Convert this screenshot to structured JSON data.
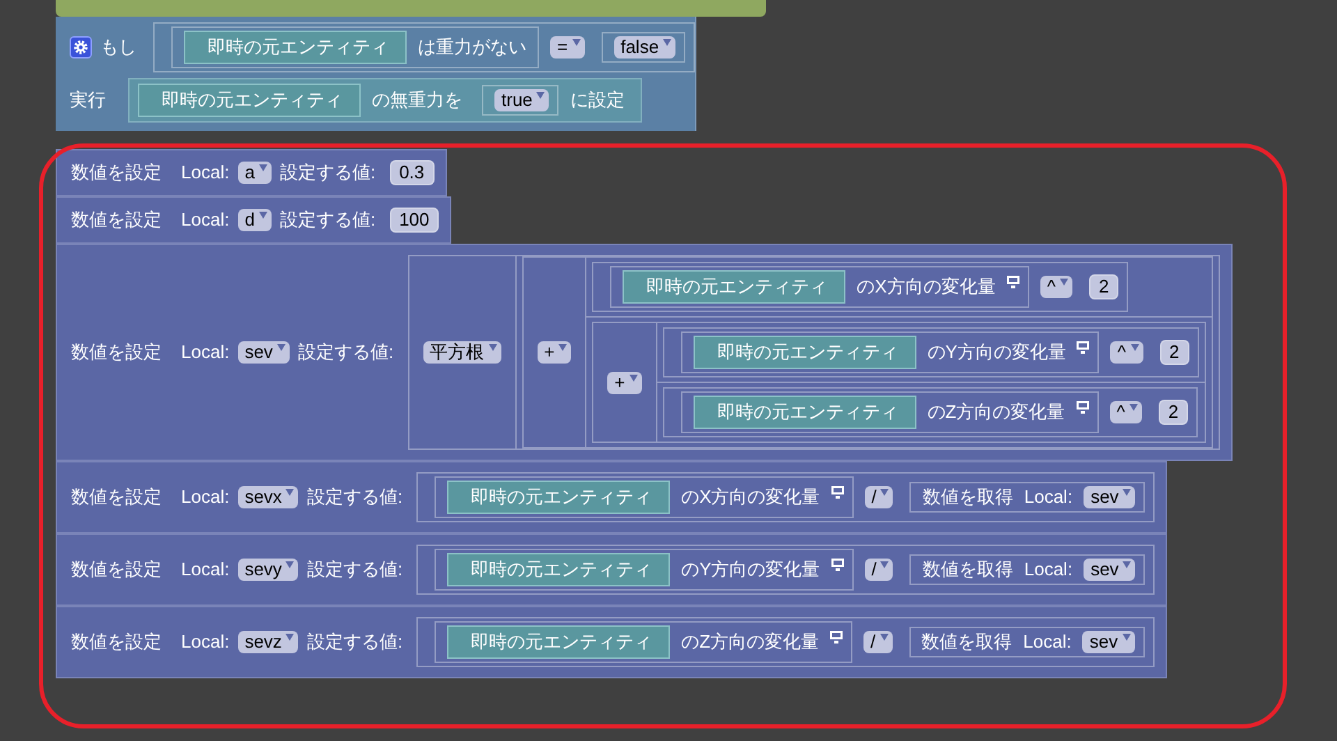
{
  "if_block": {
    "label": "もし",
    "condition": {
      "kind": "op",
      "inline": true,
      "op": "=",
      "left": {
        "kind": "property",
        "entity": "即時の元エンティティ",
        "text": "は重力がない"
      },
      "right": {
        "kind": "boolean",
        "text": "false"
      }
    },
    "do_label": "実行",
    "statement": {
      "entity": "即時の元エンティティ",
      "text_before": "の無重力を",
      "value": {
        "kind": "boolean",
        "text": "true"
      },
      "text_after": "に設定"
    }
  },
  "set_blocks": [
    {
      "label": "数値を設定",
      "scope": "Local:",
      "variable": "a",
      "value_label": "設定する値:",
      "value": {
        "kind": "number",
        "text": "0.3"
      }
    },
    {
      "label": "数値を設定",
      "scope": "Local:",
      "variable": "d",
      "value_label": "設定する値:",
      "value": {
        "kind": "number",
        "text": "100"
      }
    },
    {
      "label": "数値を設定",
      "scope": "Local:",
      "variable": "sev",
      "value_label": "設定する値:",
      "value": {
        "kind": "function",
        "function": "平方根",
        "arg": {
          "kind": "op",
          "inline": false,
          "op": "+",
          "left": {
            "kind": "op",
            "inline": true,
            "op": "^",
            "left": {
              "kind": "property",
              "entity": "即時の元エンティティ",
              "text": "のX方向の変化量",
              "monitor": true
            },
            "right": {
              "kind": "number",
              "text": "2"
            }
          },
          "right": {
            "kind": "op",
            "inline": false,
            "op": "+",
            "left": {
              "kind": "op",
              "inline": true,
              "op": "^",
              "left": {
                "kind": "property",
                "entity": "即時の元エンティティ",
                "text": "のY方向の変化量",
                "monitor": true
              },
              "right": {
                "kind": "number",
                "text": "2"
              }
            },
            "right": {
              "kind": "op",
              "inline": true,
              "op": "^",
              "left": {
                "kind": "property",
                "entity": "即時の元エンティティ",
                "text": "のZ方向の変化量",
                "monitor": true
              },
              "right": {
                "kind": "number",
                "text": "2"
              }
            }
          }
        }
      }
    },
    {
      "label": "数値を設定",
      "scope": "Local:",
      "variable": "sevx",
      "value_label": "設定する値:",
      "value": {
        "kind": "op",
        "inline": true,
        "op": "/",
        "left": {
          "kind": "property",
          "entity": "即時の元エンティティ",
          "text": "のX方向の変化量",
          "monitor": true
        },
        "right": {
          "kind": "get",
          "label": "数値を取得",
          "scope": "Local:",
          "variable": "sev"
        }
      }
    },
    {
      "label": "数値を設定",
      "scope": "Local:",
      "variable": "sevy",
      "value_label": "設定する値:",
      "value": {
        "kind": "op",
        "inline": true,
        "op": "/",
        "left": {
          "kind": "property",
          "entity": "即時の元エンティティ",
          "text": "のY方向の変化量",
          "monitor": true
        },
        "right": {
          "kind": "get",
          "label": "数値を取得",
          "scope": "Local:",
          "variable": "sev"
        }
      }
    },
    {
      "label": "数値を設定",
      "scope": "Local:",
      "variable": "sevz",
      "value_label": "設定する値:",
      "value": {
        "kind": "op",
        "inline": true,
        "op": "/",
        "left": {
          "kind": "property",
          "entity": "即時の元エンティティ",
          "text": "のZ方向の変化量",
          "monitor": true
        },
        "right": {
          "kind": "get",
          "label": "数値を取得",
          "scope": "Local:",
          "variable": "sev"
        }
      }
    }
  ]
}
